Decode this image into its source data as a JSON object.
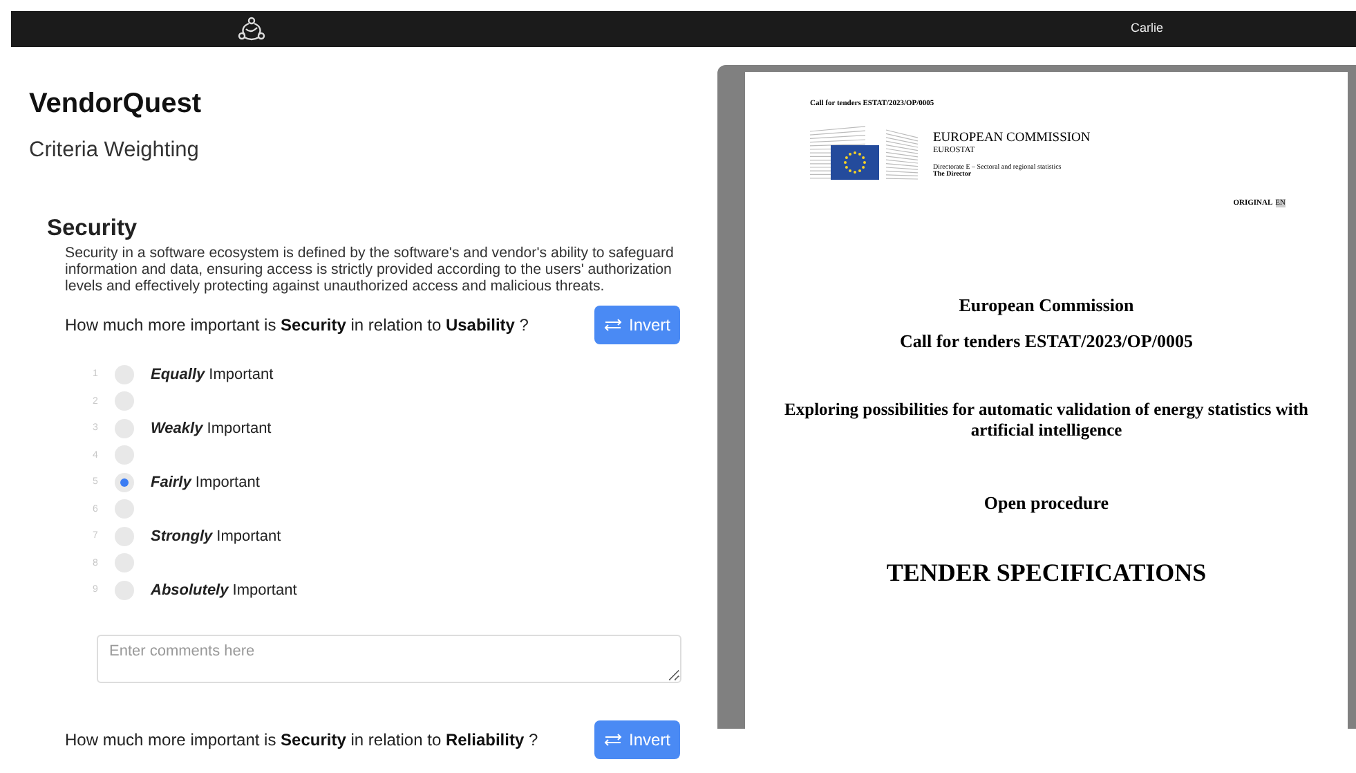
{
  "top_bar": {
    "user": "Carlie"
  },
  "app": {
    "title": "VendorQuest",
    "subtitle": "Criteria Weighting"
  },
  "criterion": {
    "name": "Security",
    "description": "Security in a software ecosystem is defined by the software's and vendor's ability to safeguard information and data, ensuring access is strictly provided according to the users' authorization levels and effectively protecting against unauthorized access and malicious threats."
  },
  "comparisons": [
    {
      "question": "How much more important is **Security** in relation to **Usability** ?",
      "button": "Invert",
      "comment_placeholder": "Enter comments here",
      "scale": [
        {
          "number": "1",
          "label": "**Equally** Important",
          "selected": false
        },
        {
          "number": "2",
          "selected": false
        },
        {
          "number": "3",
          "label": "**Weakly** Important",
          "selected": false
        },
        {
          "number": "4",
          "selected": false
        },
        {
          "number": "5",
          "label": "**Fairly** Important",
          "selected": true
        },
        {
          "number": "6",
          "selected": false
        },
        {
          "number": "7",
          "label": "**Strongly** Important",
          "selected": false
        },
        {
          "number": "8",
          "selected": false
        },
        {
          "number": "9",
          "label": "**Absolutely** Important",
          "selected": false
        }
      ]
    },
    {
      "question": "How much more important is **Security** in relation to **Reliability** ?",
      "button": "Invert"
    }
  ],
  "document": {
    "header": "Call for tenders ESTAT/2023/OP/0005",
    "organization": "EUROPEAN COMMISSION",
    "department": "EUROSTAT",
    "directorate": "Directorate E – Sectoral and regional statistics",
    "signatory": "The Director",
    "original_label": "ORIGINAL",
    "language": "EN",
    "title_lines": [
      {
        "kind": "subtitle",
        "text": "European Commission"
      },
      {
        "kind": "subtitle",
        "text": "Call for tenders ESTAT/2023/OP/0005"
      },
      {
        "kind": "subject",
        "text": "Exploring possibilities for automatic validation of energy statistics with artificial intelligence"
      },
      {
        "kind": "subtitle",
        "text": "Open procedure"
      },
      {
        "kind": "heading",
        "text": "TENDER SPECIFICATIONS"
      }
    ]
  }
}
